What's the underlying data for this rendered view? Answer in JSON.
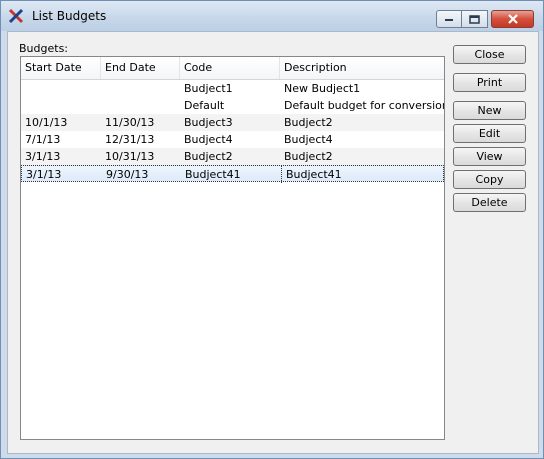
{
  "window": {
    "title": "List Budgets",
    "icon": "app-x-icon",
    "controls": [
      "minimize-icon",
      "maximize-icon",
      "close-icon"
    ]
  },
  "budgets": {
    "label": "Budgets:",
    "columns": [
      "Start Date",
      "End Date",
      "Code",
      "Description"
    ],
    "rows": [
      {
        "start": "",
        "end": "",
        "code": "Budject1",
        "description": "New Budject1"
      },
      {
        "start": "",
        "end": "",
        "code": "Default",
        "description": "Default budget for conversion"
      },
      {
        "start": "10/1/13",
        "end": "11/30/13",
        "code": "Budject3",
        "description": "Budject2"
      },
      {
        "start": "7/1/13",
        "end": "12/31/13",
        "code": "Budject4",
        "description": "Budject4"
      },
      {
        "start": "3/1/13",
        "end": "10/31/13",
        "code": "Budject2",
        "description": "Budject2"
      },
      {
        "start": "3/1/13",
        "end": "9/30/13",
        "code": "Budject41",
        "description": "Budject41"
      }
    ],
    "selected_row": 5
  },
  "buttons": {
    "close": "Close",
    "print": "Print",
    "new": "New",
    "edit": "Edit",
    "view": "View",
    "copy": "Copy",
    "delete": "Delete"
  },
  "colors": {
    "close_button": "#d4503c",
    "selection": "#dceafa"
  }
}
